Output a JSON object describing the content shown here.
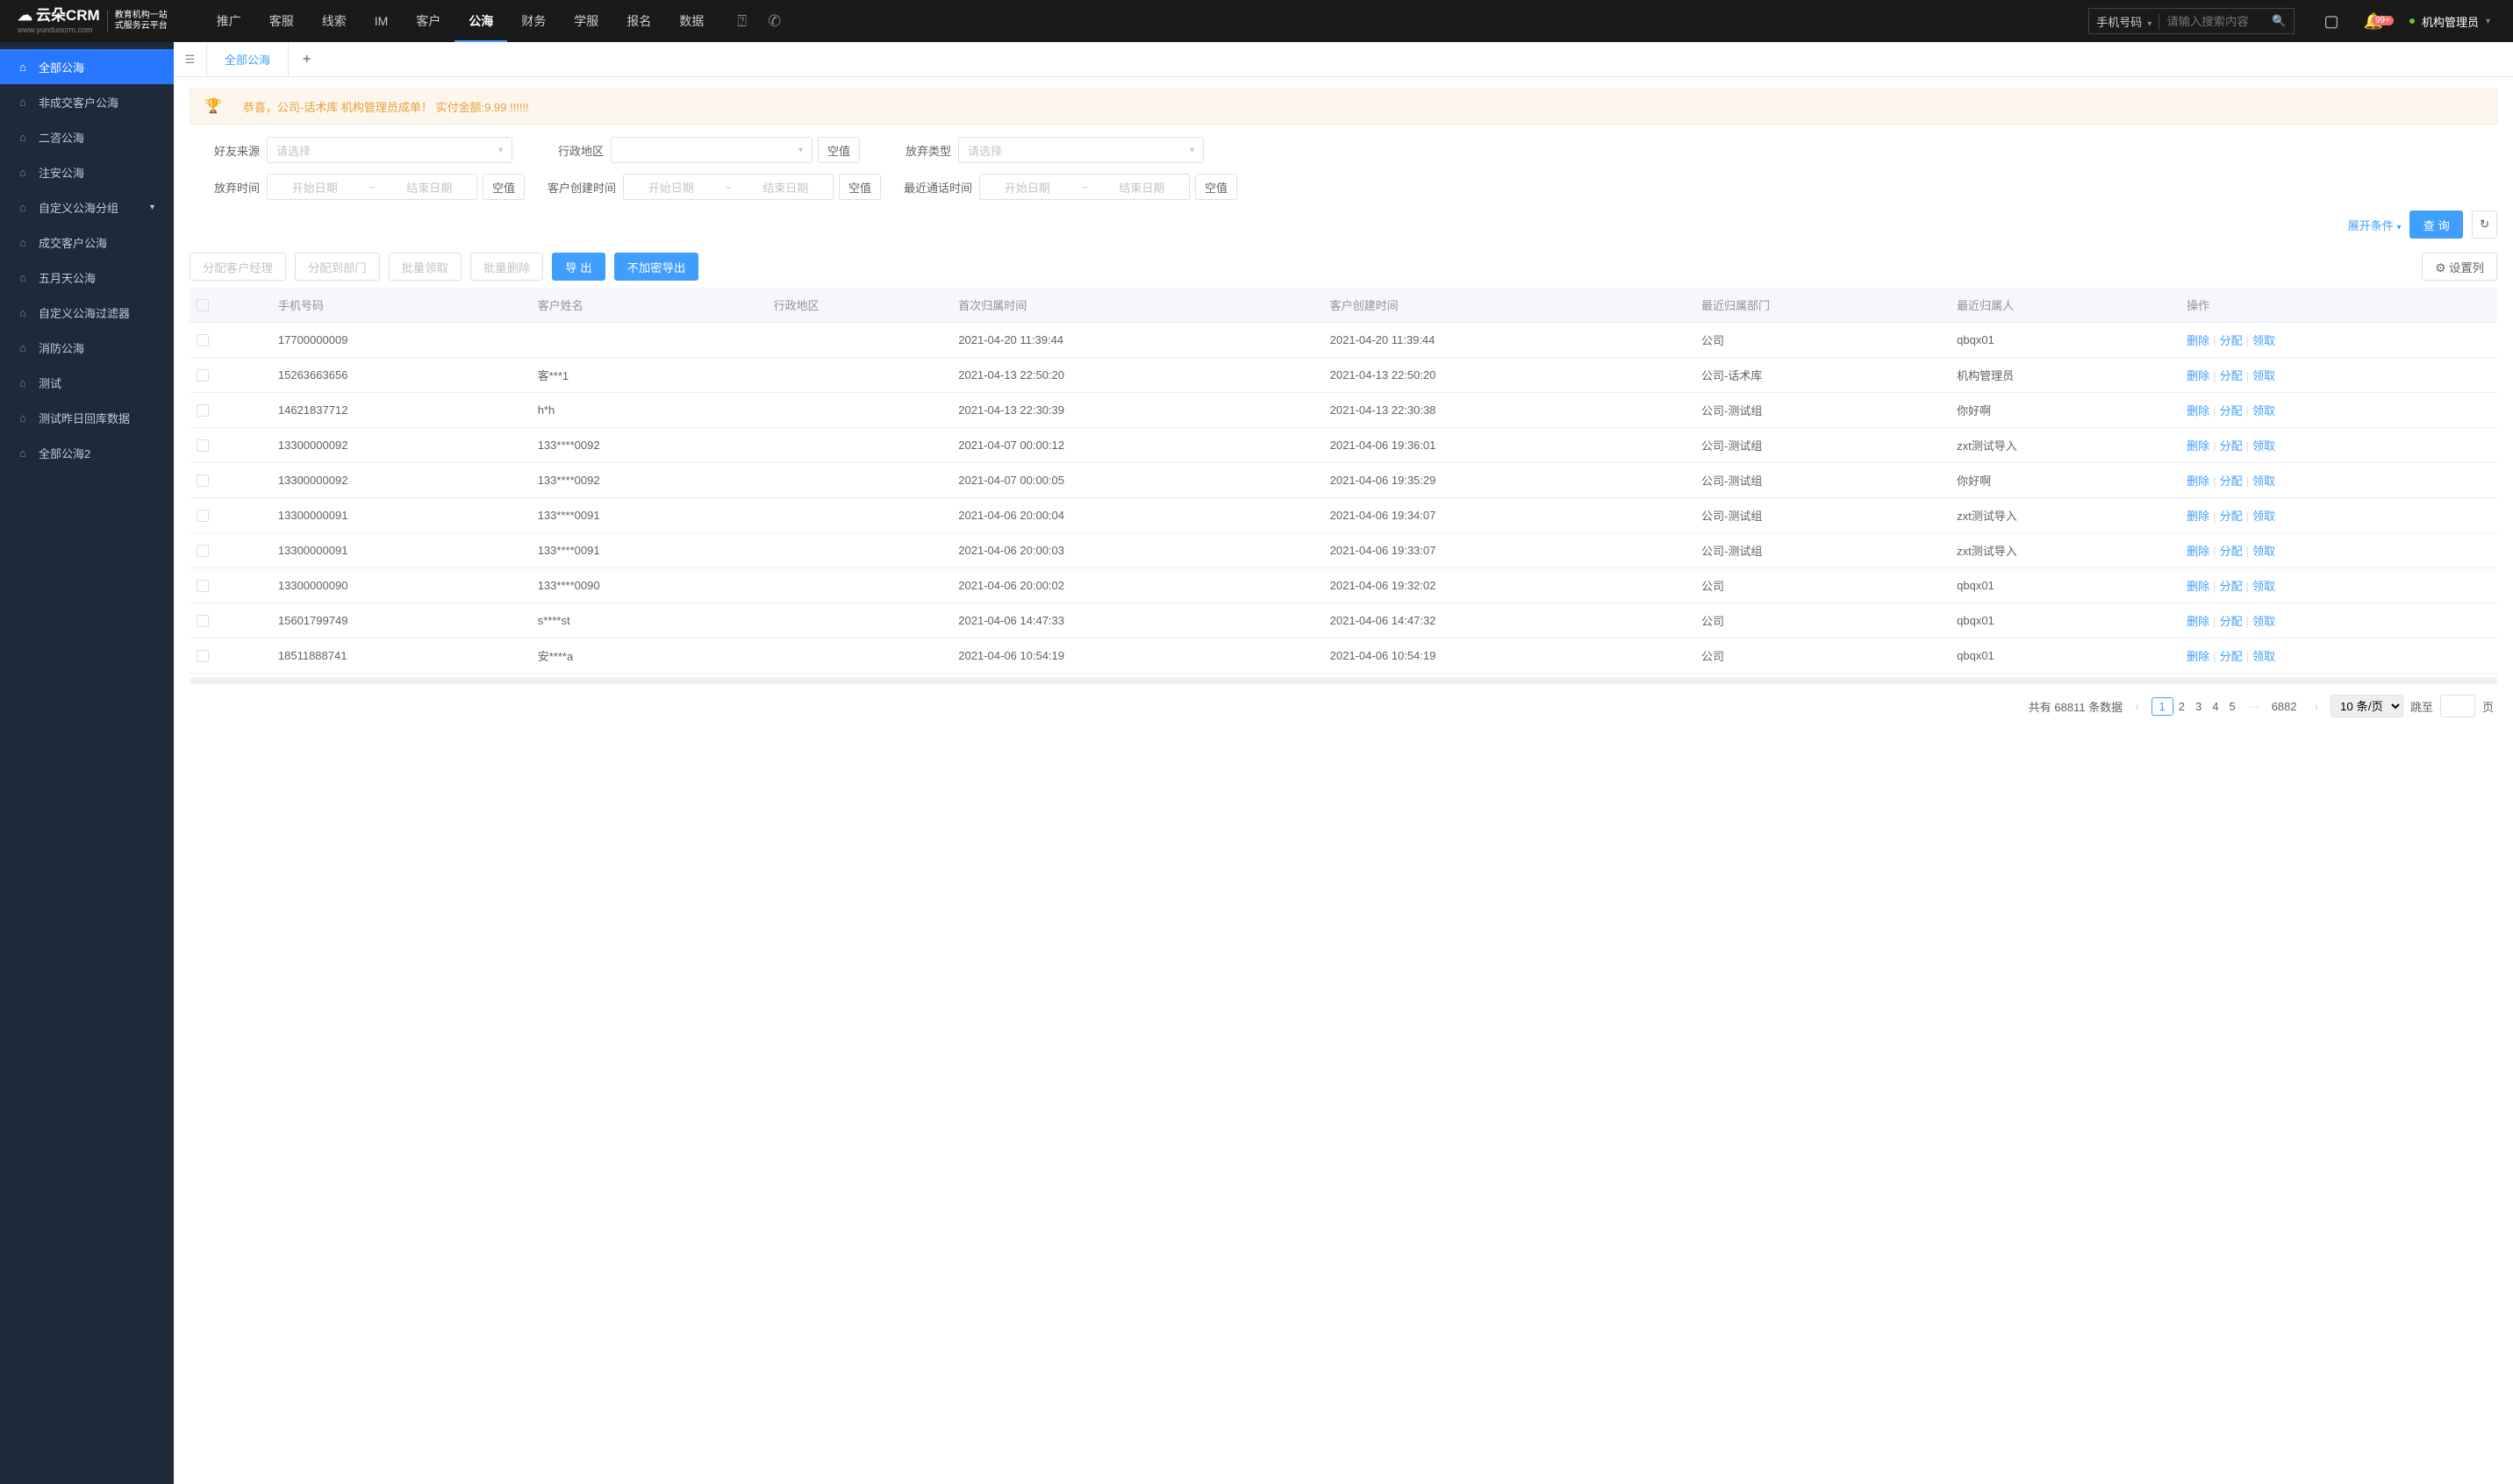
{
  "header": {
    "logo_main": "云朵CRM",
    "logo_url": "www.yunduocrm.com",
    "logo_sub1": "教育机构一站",
    "logo_sub2": "式服务云平台",
    "nav": [
      "推广",
      "客服",
      "线索",
      "IM",
      "客户",
      "公海",
      "财务",
      "学服",
      "报名",
      "数据"
    ],
    "nav_active_index": 5,
    "search_type": "手机号码",
    "search_placeholder": "请输入搜索内容",
    "badge": "99+",
    "user": "机构管理员"
  },
  "sidebar": [
    {
      "label": "全部公海",
      "active": true
    },
    {
      "label": "非成交客户公海"
    },
    {
      "label": "二咨公海"
    },
    {
      "label": "注安公海"
    },
    {
      "label": "自定义公海分组",
      "chev": true
    },
    {
      "label": "成交客户公海"
    },
    {
      "label": "五月天公海"
    },
    {
      "label": "自定义公海过滤器"
    },
    {
      "label": "消防公海"
    },
    {
      "label": "测试"
    },
    {
      "label": "测试昨日回库数据"
    },
    {
      "label": "全部公海2"
    }
  ],
  "tabs": {
    "active": "全部公海"
  },
  "banner": "恭喜，公司-话术库  机构管理员成单！  实付金额:9.99 !!!!!!",
  "filters": {
    "friend_source": {
      "label": "好友来源",
      "placeholder": "请选择"
    },
    "region": {
      "label": "行政地区",
      "empty": "空值"
    },
    "abandon_type": {
      "label": "放弃类型",
      "placeholder": "请选择"
    },
    "abandon_time": {
      "label": "放弃时间",
      "start": "开始日期",
      "end": "结束日期",
      "empty": "空值"
    },
    "create_time": {
      "label": "客户创建时间",
      "start": "开始日期",
      "end": "结束日期",
      "empty": "空值"
    },
    "call_time": {
      "label": "最近通话时间",
      "start": "开始日期",
      "end": "结束日期",
      "empty": "空值"
    },
    "expand": "展开条件",
    "query": "查 询"
  },
  "actions": {
    "assign_manager": "分配客户经理",
    "assign_dept": "分配到部门",
    "batch_claim": "批量领取",
    "batch_delete": "批量删除",
    "export": "导 出",
    "export_plain": "不加密导出",
    "columns": "设置列"
  },
  "table": {
    "headers": [
      "手机号码",
      "客户姓名",
      "行政地区",
      "首次归属时间",
      "客户创建时间",
      "最近归属部门",
      "最近归属人",
      "操作"
    ],
    "ops": {
      "delete": "删除",
      "assign": "分配",
      "claim": "领取"
    },
    "rows": [
      {
        "phone": "17700000009",
        "name": "",
        "region": "",
        "first": "2021-04-20 11:39:44",
        "created": "2021-04-20 11:39:44",
        "dept": "公司",
        "owner": "qbqx01"
      },
      {
        "phone": "15263663656",
        "name": "客***1",
        "region": "",
        "first": "2021-04-13 22:50:20",
        "created": "2021-04-13 22:50:20",
        "dept": "公司-话术库",
        "owner": "机构管理员"
      },
      {
        "phone": "14621837712",
        "name": "h*h",
        "region": "",
        "first": "2021-04-13 22:30:39",
        "created": "2021-04-13 22:30:38",
        "dept": "公司-测试组",
        "owner": "你好啊"
      },
      {
        "phone": "13300000092",
        "name": "133****0092",
        "region": "",
        "first": "2021-04-07 00:00:12",
        "created": "2021-04-06 19:36:01",
        "dept": "公司-测试组",
        "owner": "zxt测试导入"
      },
      {
        "phone": "13300000092",
        "name": "133****0092",
        "region": "",
        "first": "2021-04-07 00:00:05",
        "created": "2021-04-06 19:35:29",
        "dept": "公司-测试组",
        "owner": "你好啊"
      },
      {
        "phone": "13300000091",
        "name": "133****0091",
        "region": "",
        "first": "2021-04-06 20:00:04",
        "created": "2021-04-06 19:34:07",
        "dept": "公司-测试组",
        "owner": "zxt测试导入"
      },
      {
        "phone": "13300000091",
        "name": "133****0091",
        "region": "",
        "first": "2021-04-06 20:00:03",
        "created": "2021-04-06 19:33:07",
        "dept": "公司-测试组",
        "owner": "zxt测试导入"
      },
      {
        "phone": "13300000090",
        "name": "133****0090",
        "region": "",
        "first": "2021-04-06 20:00:02",
        "created": "2021-04-06 19:32:02",
        "dept": "公司",
        "owner": "qbqx01"
      },
      {
        "phone": "15601799749",
        "name": "s****st",
        "region": "",
        "first": "2021-04-06 14:47:33",
        "created": "2021-04-06 14:47:32",
        "dept": "公司",
        "owner": "qbqx01"
      },
      {
        "phone": "18511888741",
        "name": "安****a",
        "region": "",
        "first": "2021-04-06 10:54:19",
        "created": "2021-04-06 10:54:19",
        "dept": "公司",
        "owner": "qbqx01"
      }
    ]
  },
  "pagination": {
    "total_prefix": "共有",
    "total": "68811",
    "total_suffix": "条数据",
    "pages": [
      "1",
      "2",
      "3",
      "4",
      "5"
    ],
    "last": "6882",
    "per_page": "10 条/页",
    "jump_label": "跳至",
    "page_suffix": "页"
  }
}
